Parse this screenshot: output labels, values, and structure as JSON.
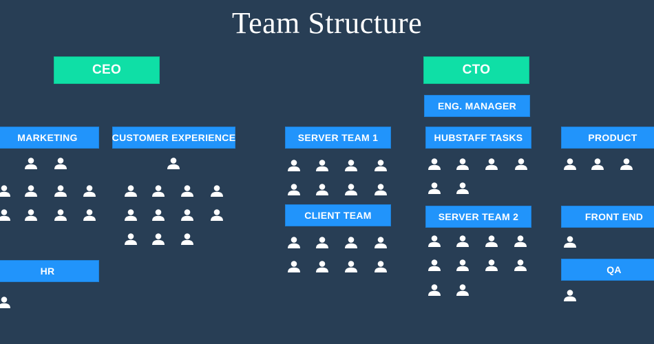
{
  "title": "Team Structure",
  "colors": {
    "background": "#283e55",
    "executive": "#0fdfa6",
    "team": "#2194fb",
    "text": "#ffffff"
  },
  "executives": [
    {
      "label": "CEO"
    },
    {
      "label": "CTO"
    }
  ],
  "teams": [
    {
      "label": "MARKETING",
      "members": 10
    },
    {
      "label": "CUSTOMER EXPERIENCE",
      "members": 12
    },
    {
      "label": "HR",
      "members": 1
    },
    {
      "label": "ENG. MANAGER",
      "members": 0
    },
    {
      "label": "SERVER TEAM 1",
      "members": 8
    },
    {
      "label": "CLIENT TEAM",
      "members": 8
    },
    {
      "label": "HUBSTAFF TASKS",
      "members": 6
    },
    {
      "label": "SERVER TEAM 2",
      "members": 10
    },
    {
      "label": "PRODUCT",
      "members": 3
    },
    {
      "label": "FRONT END",
      "members": 1
    },
    {
      "label": "QA",
      "members": 1
    }
  ]
}
